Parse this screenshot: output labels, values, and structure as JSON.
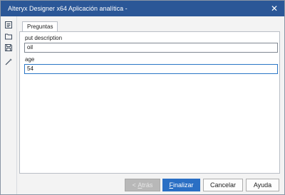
{
  "window": {
    "title": "Alteryx Designer x64 Aplicación analítica -",
    "close_icon": "close-icon"
  },
  "sidebar": {
    "items": [
      {
        "icon": "interface-icon"
      },
      {
        "icon": "folder-open-icon"
      },
      {
        "icon": "save-icon"
      },
      {
        "icon": "magic-wand-icon"
      }
    ]
  },
  "tabs": [
    {
      "label": "Preguntas"
    }
  ],
  "form": {
    "fields": [
      {
        "label": "put description",
        "value": "oil"
      },
      {
        "label": "age",
        "value": "54"
      }
    ]
  },
  "buttons": {
    "back": {
      "prefix": "< ",
      "mnemonic": "A",
      "rest": "trás"
    },
    "finish": {
      "mnemonic": "F",
      "rest": "inalizar"
    },
    "cancel": "Cancelar",
    "help": "Ayuda"
  },
  "colors": {
    "titlebar": "#2b5797",
    "primary": "#2a6fc4",
    "focus": "#2a76c6"
  }
}
